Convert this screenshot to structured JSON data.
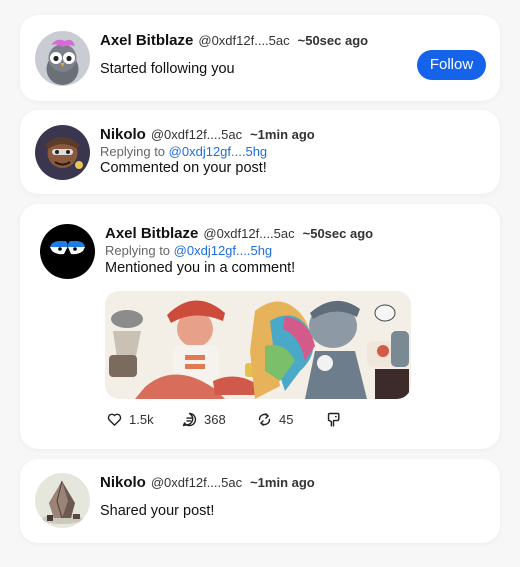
{
  "notifications": [
    {
      "name": "Axel Bitblaze",
      "handle": "@0xdf12f....5ac",
      "time": "~50sec ago",
      "message": "Started following you",
      "follow_label": "Follow"
    },
    {
      "name": "Nikolo",
      "handle": "@0xdf12f....5ac",
      "time": "~1min ago",
      "reply_prefix": "Replying to",
      "reply_to": "@0xdj12gf....5hg",
      "message": "Commented on your post!"
    },
    {
      "name": "Axel Bitblaze",
      "handle": "@0xdf12f....5ac",
      "time": "~50sec ago",
      "reply_prefix": "Replying to",
      "reply_to": "@0xdj12gf....5hg",
      "message": "Mentioned you in a comment!",
      "stats": {
        "likes": "1.5k",
        "comments": "368",
        "reposts": "45"
      }
    },
    {
      "name": "Nikolo",
      "handle": "@0xdf12f....5ac",
      "time": "~1min ago",
      "message": "Shared your post!"
    }
  ],
  "colors": {
    "accent": "#1463ea",
    "link": "#1f6fe0",
    "background": "#f7f7f8"
  },
  "icons": {
    "like": "heart-icon",
    "comment": "comment-icon",
    "repost": "repost-icon",
    "tip": "tip-icon"
  }
}
